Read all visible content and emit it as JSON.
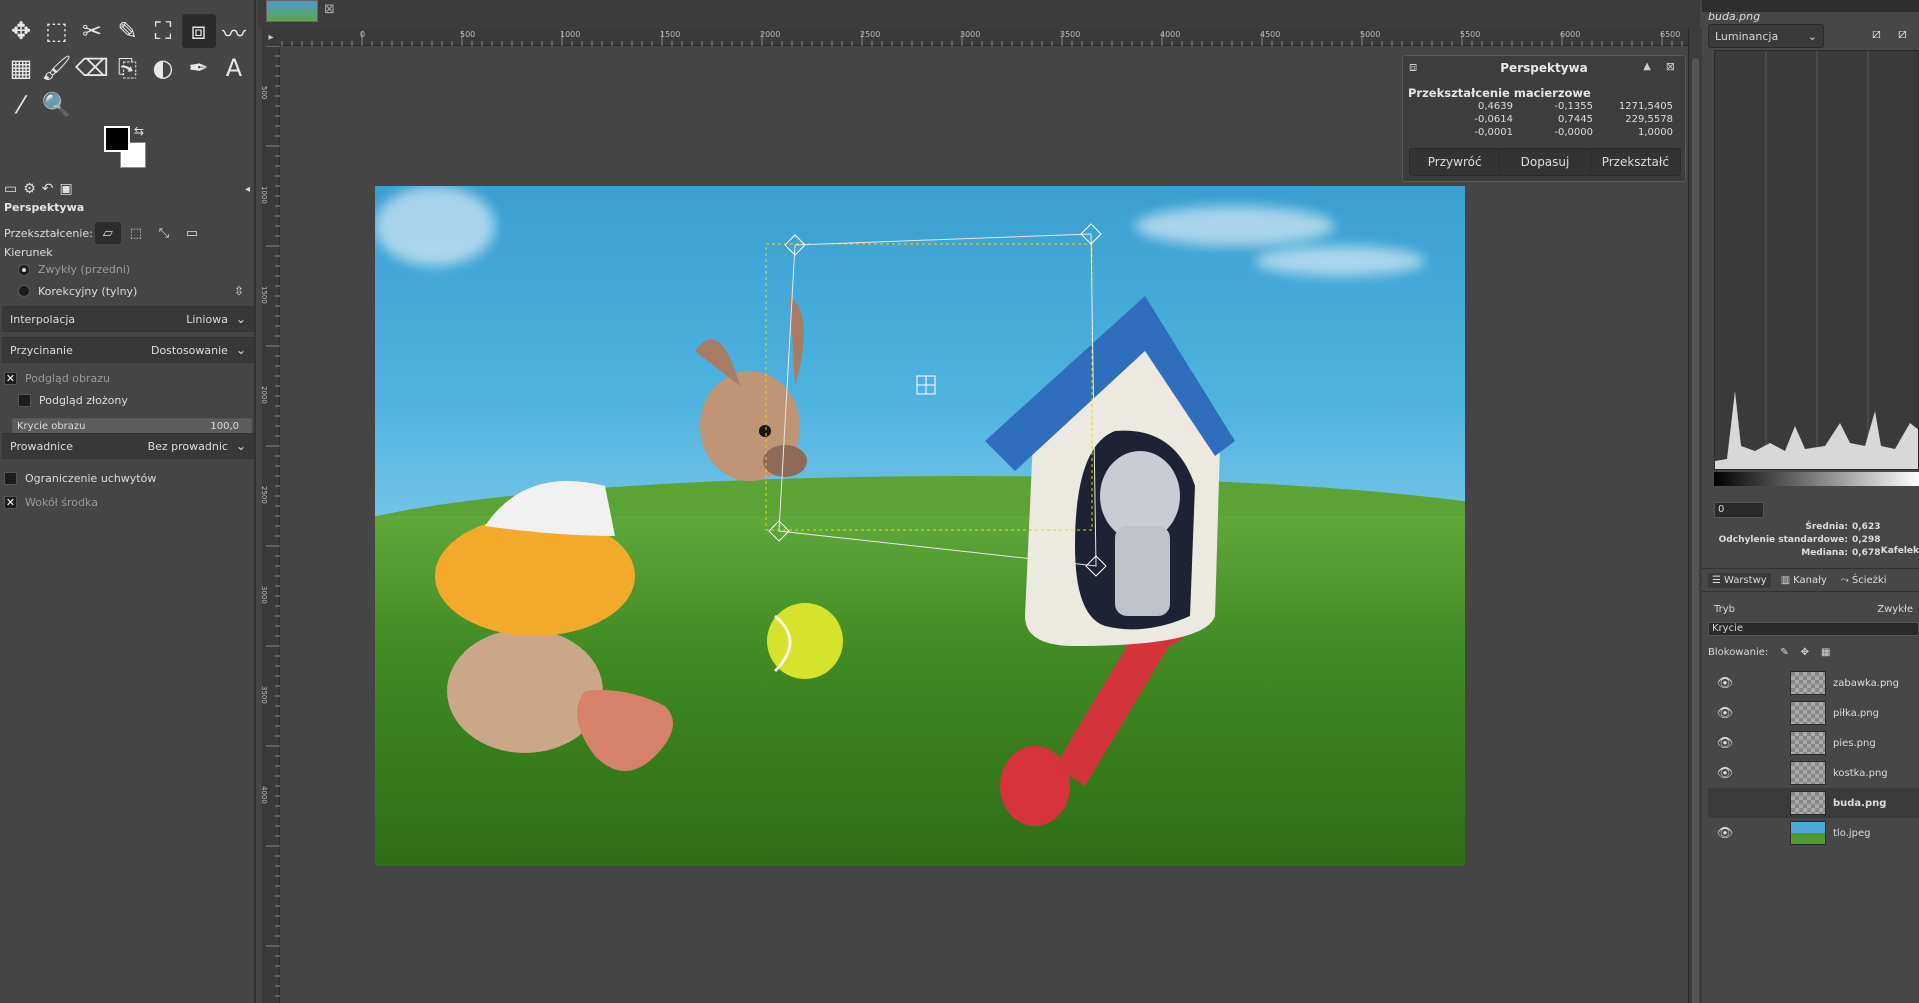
{
  "toolbox": {
    "tools": [
      {
        "name": "move-tool",
        "glyph": "✥"
      },
      {
        "name": "rect-select-tool",
        "glyph": "⬚"
      },
      {
        "name": "scissors-select-tool",
        "glyph": "✂"
      },
      {
        "name": "fuzzy-select-tool",
        "glyph": "✎"
      },
      {
        "name": "crop-tool",
        "glyph": "⛶"
      },
      {
        "name": "perspective-tool",
        "glyph": "⧈"
      },
      {
        "name": "warp-tool",
        "glyph": "〰"
      },
      {
        "name": "gradient-tool",
        "glyph": "▦"
      },
      {
        "name": "paintbrush-tool",
        "glyph": "🖌"
      },
      {
        "name": "eraser-tool",
        "glyph": "⌫"
      },
      {
        "name": "clone-tool",
        "glyph": "⎘"
      },
      {
        "name": "dodge-burn-tool",
        "glyph": "◐"
      },
      {
        "name": "path-tool",
        "glyph": "✒"
      },
      {
        "name": "text-tool",
        "glyph": "A"
      },
      {
        "name": "color-picker-tool",
        "glyph": "⁄"
      },
      {
        "name": "zoom-tool",
        "glyph": "🔍"
      }
    ],
    "fg_color": "#000000",
    "bg_color": "#ffffff"
  },
  "tool_options": {
    "title": "Perspektywa",
    "transform_label": "Przekształcenie:",
    "direction_label": "Kierunek",
    "direction_normal": "Zwykły (przedni)",
    "direction_corrective": "Korekcyjny (tylny)",
    "interpolation_label": "Interpolacja",
    "interpolation_value": "Liniowa",
    "clipping_label": "Przycinanie",
    "clipping_value": "Dostosowanie",
    "image_preview": "Podgląd obrazu",
    "composite_preview": "Podgląd złożony",
    "image_opacity_label": "Krycie obrazu",
    "image_opacity_value": "100,0",
    "image_opacity_level": 1.0,
    "guides_label": "Prowadnice",
    "guides_value": "Bez prowadnic",
    "constrain_handles": "Ograniczenie uchwytów",
    "around_center": "Wokół środka"
  },
  "ruler": {
    "top_labels": [
      "0",
      "500",
      "1000",
      "1500",
      "2000",
      "2500",
      "3000",
      "3500",
      "4000",
      "4500",
      "5000",
      "5500",
      "6000",
      "6500"
    ],
    "left_labels": [
      "500",
      "1000",
      "1500",
      "2000",
      "2500",
      "3000",
      "3500",
      "4000"
    ]
  },
  "perspective_dialog": {
    "title": "Perspektywa",
    "subtitle": "Przekształcenie macierzowe",
    "matrix": [
      [
        "0,4639",
        "-0,1355",
        "1271,5405"
      ],
      [
        "-0,0614",
        "0,7445",
        "229,5578"
      ],
      [
        "-0,0001",
        "-0,0000",
        "1,0000"
      ]
    ],
    "btn_reset": "Przywróć",
    "btn_readjust": "Dopasuj",
    "btn_transform": "Przekształć"
  },
  "histogram": {
    "filename": "buda.png",
    "channel": "Luminancja",
    "range_start": "0",
    "mean_label": "Średnia:",
    "mean_value": "0,623",
    "stddev_label": "Odchylenie standardowe:",
    "stddev_value": "0,298",
    "median_label": "Mediana:",
    "median_value": "0,678",
    "tile_label": "Kafelek"
  },
  "layers_panel": {
    "tab_layers": "Warstwy",
    "tab_channels": "Kanały",
    "tab_paths": "Ścieżki",
    "mode_label": "Tryb",
    "mode_value": "Zwykłe",
    "opacity_label": "Krycie",
    "lock_label": "Blokowanie:",
    "layers": [
      {
        "name": "zabawka.png",
        "visible": true,
        "active": false
      },
      {
        "name": "piłka.png",
        "visible": true,
        "active": false
      },
      {
        "name": "pies.png",
        "visible": true,
        "active": false
      },
      {
        "name": "kostka.png",
        "visible": true,
        "active": false
      },
      {
        "name": "buda.png",
        "visible": false,
        "active": true
      },
      {
        "name": "tlo.jpeg",
        "visible": true,
        "active": false
      }
    ]
  }
}
